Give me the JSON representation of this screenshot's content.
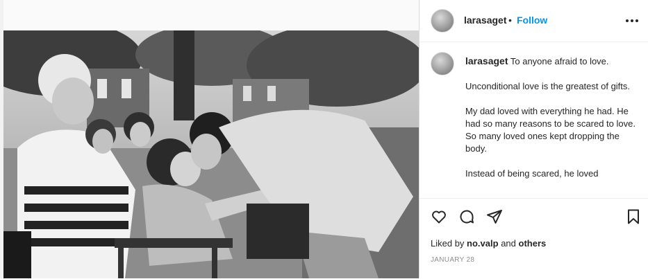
{
  "post": {
    "image": {
      "alt": "Black-and-white photo of a man bending down to kiss a young girl on the nose while older women sit and watch"
    }
  },
  "header": {
    "username": "larasaget",
    "separator": "•",
    "follow_label": "Follow"
  },
  "caption": {
    "username": "larasaget",
    "lines": [
      "To anyone afraid to love.",
      "Unconditional love is the greatest of gifts.",
      "My dad loved with everything he had. He had so many reasons to be scared to love.\nSo many loved ones kept dropping the body.",
      "Instead of being scared, he loved"
    ]
  },
  "engagement": {
    "liked_by_prefix": "Liked by",
    "liked_by_user": "no.valp",
    "and_label": "and",
    "others_label": "others",
    "date": "JANUARY 28"
  },
  "icons": [
    "heart-icon",
    "comment-icon",
    "share-icon",
    "bookmark-icon",
    "more-options-icon"
  ],
  "colors": {
    "accent": "#0095f6",
    "text": "#262626",
    "muted": "#8e8e8e"
  }
}
